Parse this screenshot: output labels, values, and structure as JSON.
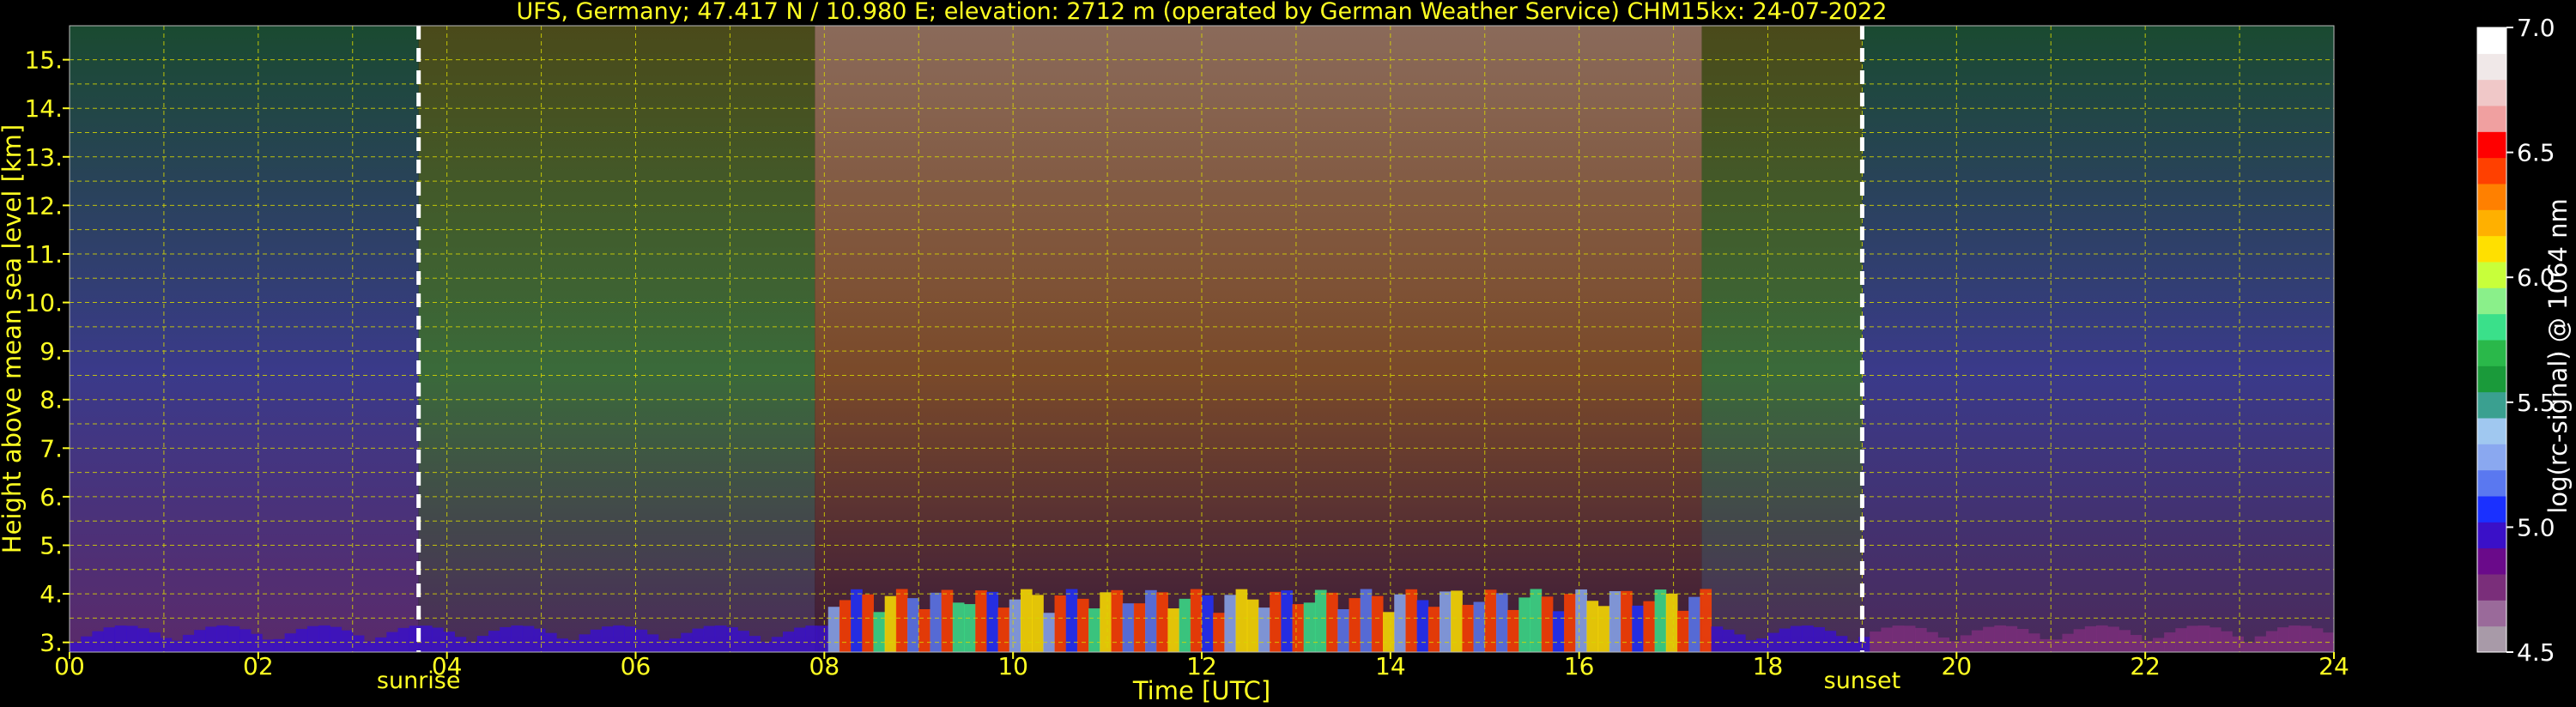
{
  "chart_data": {
    "type": "heatmap",
    "title": "UFS, Germany; 47.417 N / 10.980 E; elevation: 2712 m  (operated by German Weather Service)    CHM15kx: 24-07-2022",
    "xlabel": "Time [UTC]",
    "ylabel": "Height above mean sea level [km]",
    "colorbar_label": "log(rc-signal) @ 1064 nm",
    "x_ticks": [
      "00",
      "02",
      "04",
      "06",
      "08",
      "10",
      "12",
      "14",
      "16",
      "18",
      "20",
      "22",
      "24"
    ],
    "y_ticks": [
      "3.",
      "4.",
      "5.",
      "6.",
      "7.",
      "8.",
      "9.",
      "10.",
      "11.",
      "12.",
      "13.",
      "14.",
      "15."
    ],
    "colorbar_ticks": [
      "4.5",
      "5.0",
      "5.5",
      "6.0",
      "6.5",
      "7.0"
    ],
    "xlim": [
      0,
      24
    ],
    "ylim": [
      2.8,
      15.7
    ],
    "clim": [
      4.5,
      7.0
    ],
    "grid": true,
    "annotations": [
      {
        "label": "sunrise",
        "time": 3.7
      },
      {
        "label": "sunset",
        "time": 19.0
      }
    ],
    "colors": {
      "text": "#ffff22",
      "grid": "#d8d800",
      "marker": "#ffffff",
      "colorbar": [
        "#a89aa8",
        "#9a6a9a",
        "#7a2e7a",
        "#6a0a8a",
        "#3a10c8",
        "#1a30ff",
        "#5a78f0",
        "#8aa8f0",
        "#a0c8f0",
        "#3aa090",
        "#1a9a3a",
        "#2ab84a",
        "#3ae08a",
        "#8af08a",
        "#c8ff3a",
        "#ffe000",
        "#ffb000",
        "#ff8000",
        "#ff4000",
        "#ff0000",
        "#f0a0a0",
        "#f0c8c8",
        "#f0e8e8",
        "#ffffff"
      ]
    }
  }
}
